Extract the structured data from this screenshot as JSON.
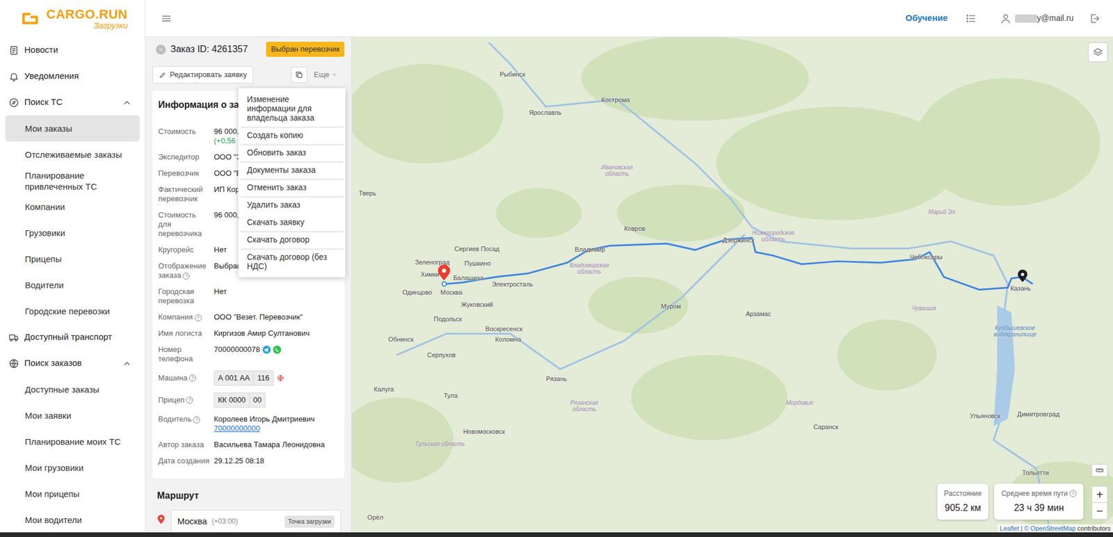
{
  "logo": {
    "name": "CARGO.RUN",
    "sub": "Загрузки"
  },
  "topbar": {
    "training": "Обучение",
    "email": "y@mail.ru"
  },
  "sidebar": {
    "items": [
      {
        "label": "Новости",
        "kind": "top",
        "selected": false
      },
      {
        "label": "Уведомления",
        "kind": "top",
        "selected": false
      },
      {
        "label": "Поиск ТС",
        "kind": "group",
        "selected": false,
        "expanded": true
      },
      {
        "label": "Мои заказы",
        "kind": "sub",
        "selected": true
      },
      {
        "label": "Отслеживаемые заказы",
        "kind": "sub",
        "selected": false
      },
      {
        "label": "Планирование привлеченных ТС",
        "kind": "sub",
        "selected": false
      },
      {
        "label": "Компании",
        "kind": "sub",
        "selected": false
      },
      {
        "label": "Грузовики",
        "kind": "sub",
        "selected": false
      },
      {
        "label": "Прицепы",
        "kind": "sub",
        "selected": false
      },
      {
        "label": "Водители",
        "kind": "sub",
        "selected": false
      },
      {
        "label": "Городские перевозки",
        "kind": "sub",
        "selected": false
      },
      {
        "label": "Доступный транспорт",
        "kind": "top",
        "selected": false
      },
      {
        "label": "Поиск заказов",
        "kind": "group",
        "selected": false,
        "expanded": true
      },
      {
        "label": "Доступные заказы",
        "kind": "sub",
        "selected": false
      },
      {
        "label": "Мои заявки",
        "kind": "sub",
        "selected": false
      },
      {
        "label": "Планирование моих ТС",
        "kind": "sub",
        "selected": false
      },
      {
        "label": "Мои грузовики",
        "kind": "sub",
        "selected": false
      },
      {
        "label": "Мои прицепы",
        "kind": "sub",
        "selected": false
      },
      {
        "label": "Мои водители",
        "kind": "sub",
        "selected": false
      }
    ]
  },
  "order": {
    "title": "Заказ ID: 4261357",
    "status": "Выбран перевозчик",
    "edit_button": "Редактировать заявку",
    "more_button": "Еще",
    "info_title": "Информация о зака",
    "fields": [
      {
        "label": "Стоимость",
        "value": "96 000,",
        "note": "(+0,56",
        "kind": "text"
      },
      {
        "label": "Экспедитор",
        "value": "ООО \"Э",
        "kind": "text"
      },
      {
        "label": "Перевозчик",
        "value": "ООО \"В",
        "kind": "text"
      },
      {
        "label": "Фактический перевозчик",
        "value": "ИП Кор",
        "kind": "text"
      },
      {
        "label": "Стоимость для перевозчика",
        "value": "96 000,",
        "kind": "text"
      },
      {
        "label": "Кругорейс",
        "value": "Нет",
        "kind": "text"
      },
      {
        "label": "Отображение заказа",
        "hint": "?",
        "value": "Выбран",
        "kind": "text"
      },
      {
        "label": "Городская перевозка",
        "value": "Нет",
        "kind": "text"
      },
      {
        "label": "Компания",
        "hint": "?",
        "value": "ООО \"Везет. Перевозчик\"",
        "kind": "text"
      },
      {
        "label": "Имя логиста",
        "value": "Киргизов Амир Султанович",
        "kind": "text"
      },
      {
        "label": "Номер телефона",
        "value": "70000000078",
        "kind": "phone"
      },
      {
        "label": "Машина",
        "hint": "?",
        "plate": [
          "А 001 АА",
          "116"
        ],
        "kind": "vehicle"
      },
      {
        "label": "Прицеп",
        "hint": "?",
        "plate": [
          "КК 0000",
          "00"
        ],
        "kind": "plate"
      },
      {
        "label": "Водитель",
        "hint": "?",
        "value": "Королеев Игорь Дмитриевич",
        "link": "70000000000",
        "kind": "driver"
      },
      {
        "label": "Автор заказа",
        "value": "Васильева Тамара Леонидовна",
        "kind": "text"
      },
      {
        "label": "Дата создания",
        "value": "29.12.25 08:18",
        "kind": "text"
      }
    ],
    "route_title": "Маршрут",
    "route": [
      {
        "city": "Москва",
        "tz": "(+03:00)",
        "badge": "Точка загрузки"
      }
    ]
  },
  "menu": {
    "items": [
      {
        "label": "Изменение информации для владельца заказа",
        "selected": false
      },
      {
        "label": "Создать копию",
        "selected": false
      },
      {
        "label": "Обновить заказ",
        "selected": false
      },
      {
        "label": "Документы заказа",
        "selected": false
      },
      {
        "label": "Отменить заказ",
        "selected": false
      },
      {
        "label": "Удалить заказ",
        "selected": false
      },
      {
        "label": "Скачать заявку",
        "selected": true
      },
      {
        "label": "Скачать договор",
        "selected": false
      },
      {
        "label": "Скачать договор (без НДС)",
        "selected": false
      }
    ]
  },
  "map": {
    "labels": [
      {
        "text": "Рыбинск",
        "kind": "city"
      },
      {
        "text": "Ярославль",
        "kind": "city"
      },
      {
        "text": "Кострома",
        "kind": "city"
      },
      {
        "text": "Тверь",
        "kind": "city"
      },
      {
        "text": "Ивановская область",
        "kind": "region"
      },
      {
        "text": "Сергиев Посад",
        "kind": "city"
      },
      {
        "text": "Ковров",
        "kind": "city"
      },
      {
        "text": "Владимир",
        "kind": "city"
      },
      {
        "text": "Владимирская область",
        "kind": "region"
      },
      {
        "text": "Дзержинск",
        "kind": "city"
      },
      {
        "text": "Нижегородская область",
        "kind": "region"
      },
      {
        "text": "Марий Эл",
        "kind": "region"
      },
      {
        "text": "Чебоксары",
        "kind": "city"
      },
      {
        "text": "Чувашия",
        "kind": "region"
      },
      {
        "text": "Казань",
        "kind": "city"
      },
      {
        "text": "Зеленоград",
        "kind": "city"
      },
      {
        "text": "Пушкино",
        "kind": "city"
      },
      {
        "text": "Химки",
        "kind": "city"
      },
      {
        "text": "Балашиха",
        "kind": "city"
      },
      {
        "text": "Электросталь",
        "kind": "city"
      },
      {
        "text": "Одинцово",
        "kind": "city"
      },
      {
        "text": "Москва",
        "kind": "city"
      },
      {
        "text": "Жуковский",
        "kind": "city"
      },
      {
        "text": "Подольск",
        "kind": "city"
      },
      {
        "text": "Воскресенск",
        "kind": "city"
      },
      {
        "text": "Обнинск",
        "kind": "city"
      },
      {
        "text": "Коломна",
        "kind": "city"
      },
      {
        "text": "Серпухов",
        "kind": "city"
      },
      {
        "text": "Муром",
        "kind": "city"
      },
      {
        "text": "Арзамас",
        "kind": "city"
      },
      {
        "text": "Рязань",
        "kind": "city"
      },
      {
        "text": "Калуга",
        "kind": "city"
      },
      {
        "text": "Тула",
        "kind": "city"
      },
      {
        "text": "Рязанская область",
        "kind": "region"
      },
      {
        "text": "Мордовия",
        "kind": "region"
      },
      {
        "text": "Саранск",
        "kind": "city"
      },
      {
        "text": "Ульяновск",
        "kind": "city"
      },
      {
        "text": "Димитровград",
        "kind": "city"
      },
      {
        "text": "Новомосковск",
        "kind": "city"
      },
      {
        "text": "Тульская область",
        "kind": "region"
      },
      {
        "text": "Тольятти",
        "kind": "city"
      },
      {
        "text": "Орёл",
        "kind": "city"
      },
      {
        "text": "Куйбышевское водохранилище",
        "kind": "water"
      }
    ],
    "distance": {
      "label": "Расстояние",
      "value": "905.2 км"
    },
    "duration": {
      "label": "Среднее время пути",
      "hint": "?",
      "value": "23 ч 39 мин"
    },
    "zoom_in": "+",
    "zoom_out": "−",
    "attribution": [
      "Leaflet",
      "|",
      "© OpenStreetMap",
      "contributors"
    ]
  }
}
